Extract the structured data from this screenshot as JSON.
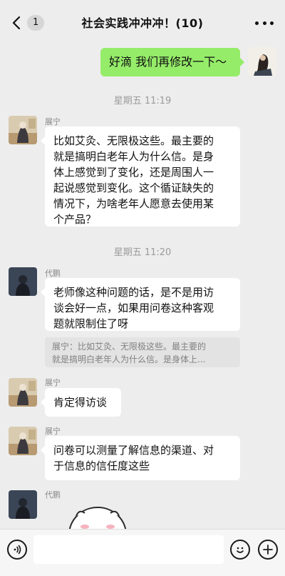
{
  "header": {
    "back_label": "<",
    "unread_count": "1",
    "title": "社会实践冲冲冲！(10)"
  },
  "messages": {
    "m1": {
      "text": "好滴 我们再修改一下～"
    },
    "time1": "星期五 11:19",
    "m2": {
      "sender": "展宁",
      "lines": [
        "比如艾灸、无限极这些。最主要的",
        "就是搞明白老年人为什么信。是身",
        "体上感觉到了变化，还是周围人一",
        "起说感觉到变化。这个循证缺失的",
        "情况下，为啥老年人愿意去使用某",
        "个产品？"
      ]
    },
    "time2": "星期五 11:20",
    "m3": {
      "sender": "代鹏",
      "lines": [
        "老师像这种问题的话，是不是用访",
        "谈会好一点，如果用问卷这种客观",
        "题就限制住了呀"
      ],
      "quote_lines": [
        "展宁：比如艾灸、无限极这些。最主要的",
        "就是搞明白老年人为什么信。是身体上..."
      ]
    },
    "m4": {
      "sender": "展宁",
      "text": "肯定得访谈"
    },
    "m5": {
      "sender": "展宁",
      "lines": [
        "问卷可以测量了解信息的渠道、对",
        "于信息的信任度这些"
      ]
    },
    "m6": {
      "sender": "代鹏"
    }
  },
  "input": {
    "value": "",
    "placeholder": ""
  },
  "icons": {
    "back": "chevron-left-icon",
    "more": "more-dots-icon",
    "voice": "voice-icon",
    "emoji": "emoji-icon",
    "plus": "plus-icon",
    "sticker": "sticker-icon"
  },
  "colors": {
    "accent": "#95ec69",
    "background": "#ededed",
    "bubble": "#ffffff"
  }
}
